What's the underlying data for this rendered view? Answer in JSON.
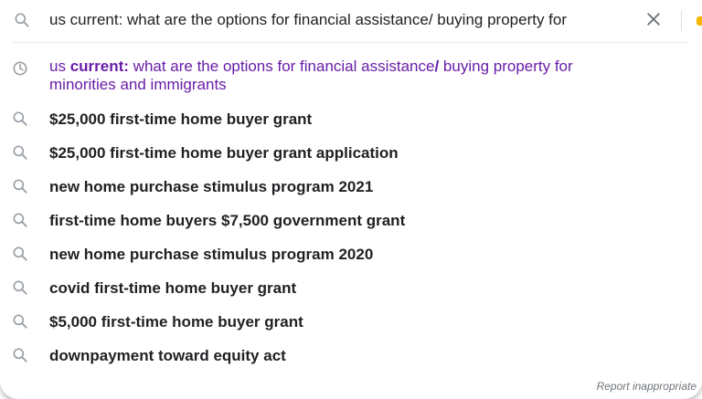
{
  "search": {
    "query": "us current: what are the options for financial assistance/ buying property for"
  },
  "history_item": {
    "bold_prefix": "us",
    "bold_term": "current:",
    "rest_line1": " what are the options for financial assistance",
    "bold_slash": "/",
    "rest_line1b": " buying property for",
    "line2": "minorities and immigrants",
    "icon": "clock-icon",
    "color": "#681da8"
  },
  "suggestions": [
    {
      "label": "$25,000 first-time home buyer grant"
    },
    {
      "label": "$25,000 first-time home buyer grant application"
    },
    {
      "label": "new home purchase stimulus program 2021"
    },
    {
      "label": "first-time home buyers $7,500 government grant"
    },
    {
      "label": "new home purchase stimulus program 2020"
    },
    {
      "label": "covid first-time home buyer grant"
    },
    {
      "label": "$5,000 first-time home buyer grant"
    },
    {
      "label": "downpayment toward equity act"
    }
  ],
  "footer": {
    "report_label": "Report inappropriate"
  },
  "colors": {
    "text": "#202124",
    "icon": "#9aa0a6",
    "visited": "#681da8",
    "muted": "#70757a"
  }
}
